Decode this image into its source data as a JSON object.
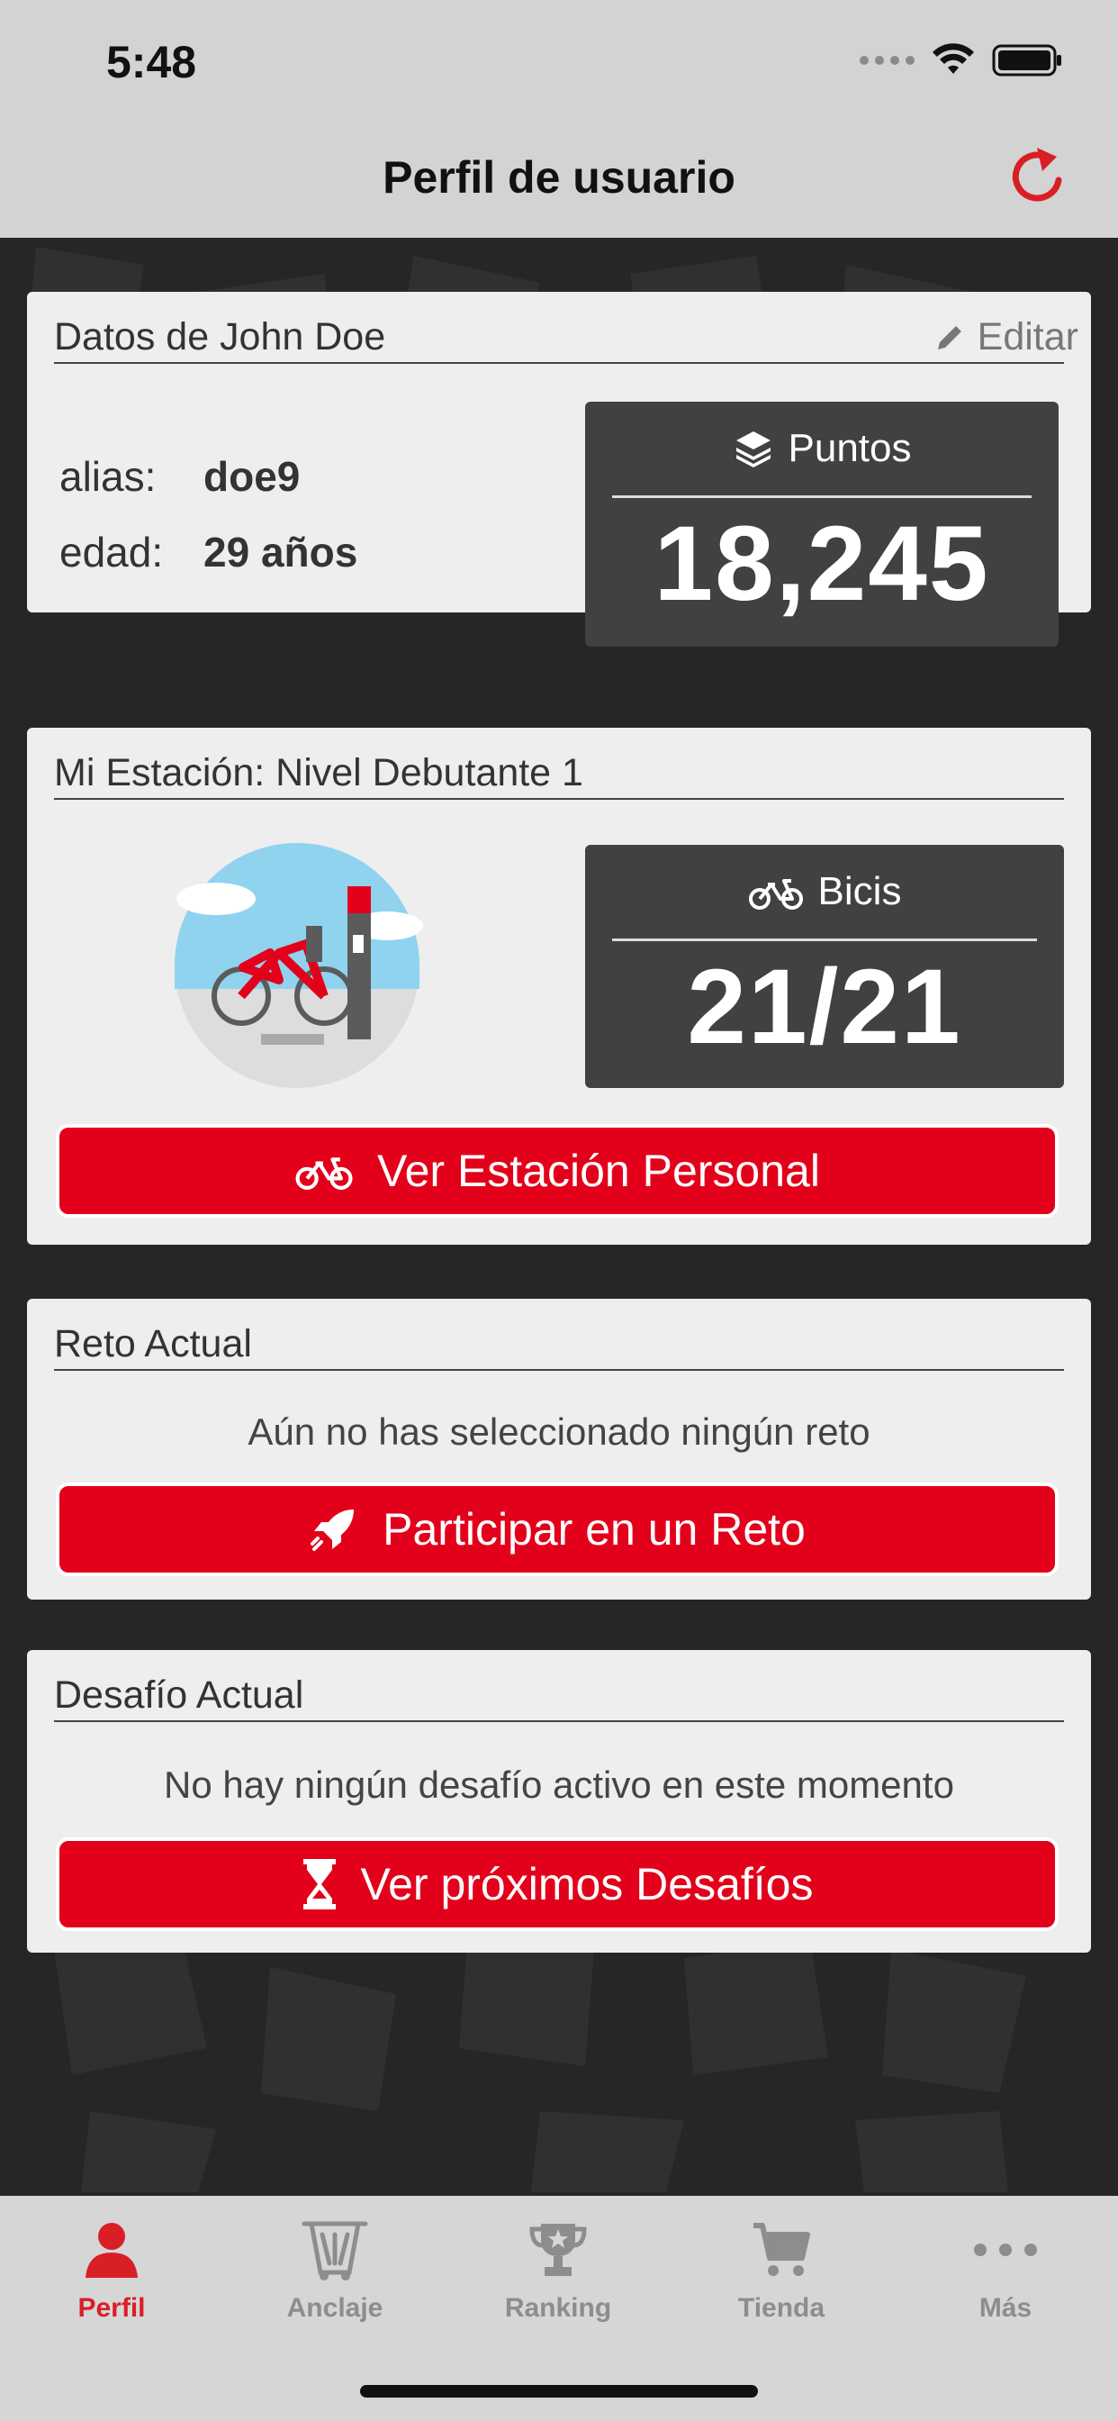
{
  "status_bar": {
    "time": "5:48"
  },
  "nav": {
    "title": "Perfil de usuario",
    "refresh_icon": "refresh-icon"
  },
  "profile_card": {
    "title": "Datos de John Doe",
    "edit_label": "Editar",
    "alias_label": "alias:",
    "alias_value": "doe9",
    "age_label": "edad:",
    "age_value": "29 años",
    "points_label": "Puntos",
    "points_value": "18,245"
  },
  "station_card": {
    "title": "Mi Estación: Nivel Debutante 1",
    "bikes_label": "Bicis",
    "bikes_value": "21/21",
    "button_label": "Ver Estación Personal"
  },
  "challenge_card": {
    "title": "Reto Actual",
    "message": "Aún no has seleccionado ningún reto",
    "button_label": "Participar en un Reto"
  },
  "duel_card": {
    "title": "Desafío Actual",
    "message": "No hay ningún desafío activo en este momento",
    "button_label": "Ver próximos Desafíos"
  },
  "tab_bar": {
    "active_color": "#d91f26",
    "inactive_color": "#8d8d8d",
    "tabs": [
      {
        "label": "Perfil",
        "icon": "user-icon",
        "active": true
      },
      {
        "label": "Anclaje",
        "icon": "dock-icon",
        "active": false
      },
      {
        "label": "Ranking",
        "icon": "trophy-icon",
        "active": false
      },
      {
        "label": "Tienda",
        "icon": "cart-icon",
        "active": false
      },
      {
        "label": "Más",
        "icon": "more-icon",
        "active": false
      }
    ]
  },
  "colors": {
    "accent": "#e3001b",
    "card_bg": "#eeeeee",
    "stat_bg": "#414141"
  }
}
